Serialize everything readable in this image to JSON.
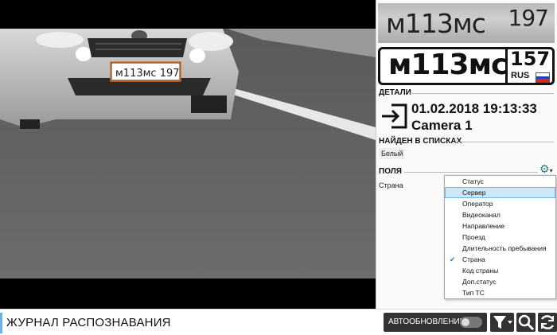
{
  "recognition": {
    "crop_text": "м113мс",
    "crop_region": "197",
    "plate_number": "м113мс",
    "plate_region": "157",
    "plate_country": "RUS",
    "video_plate_text": "м113мс 197"
  },
  "details": {
    "section_title": "ДЕТАЛИ",
    "datetime": "01.02.2018 19:13:33",
    "camera": "Camera 1",
    "direction_icon": "enter-icon"
  },
  "lists": {
    "section_title": "НАЙДЕН В СПИСКАХ",
    "items": [
      "Белый"
    ]
  },
  "fields": {
    "section_title": "ПОЛЯ",
    "visible_field": "Страна",
    "settings_icon": "gear-icon",
    "menu": [
      {
        "label": "Статус",
        "checked": false
      },
      {
        "label": "Сервер",
        "checked": false,
        "highlighted": true
      },
      {
        "label": "Оператор",
        "checked": false
      },
      {
        "label": "Видеоканал",
        "checked": false
      },
      {
        "label": "Направление",
        "checked": false
      },
      {
        "label": "Проезд",
        "checked": false
      },
      {
        "label": "Длительность пребывания",
        "checked": false
      },
      {
        "label": "Страна",
        "checked": true
      },
      {
        "label": "Код страны",
        "checked": false
      },
      {
        "label": "Доп.статус",
        "checked": false
      },
      {
        "label": "Тип ТС",
        "checked": false
      }
    ]
  },
  "bottom_bar": {
    "title": "ЖУРНАЛ РАСПОЗНАВАНИЯ",
    "auto_update_label": "АВТООБНОВЛЕНИЕ",
    "auto_update_on": false,
    "buttons": [
      "filter-icon",
      "search-icon",
      "refresh-icon"
    ]
  },
  "colors": {
    "accent": "#6db3e6",
    "gear": "#2b7f72",
    "menu_highlight": "#cde8f8",
    "plate_box": "#e06a1a"
  }
}
